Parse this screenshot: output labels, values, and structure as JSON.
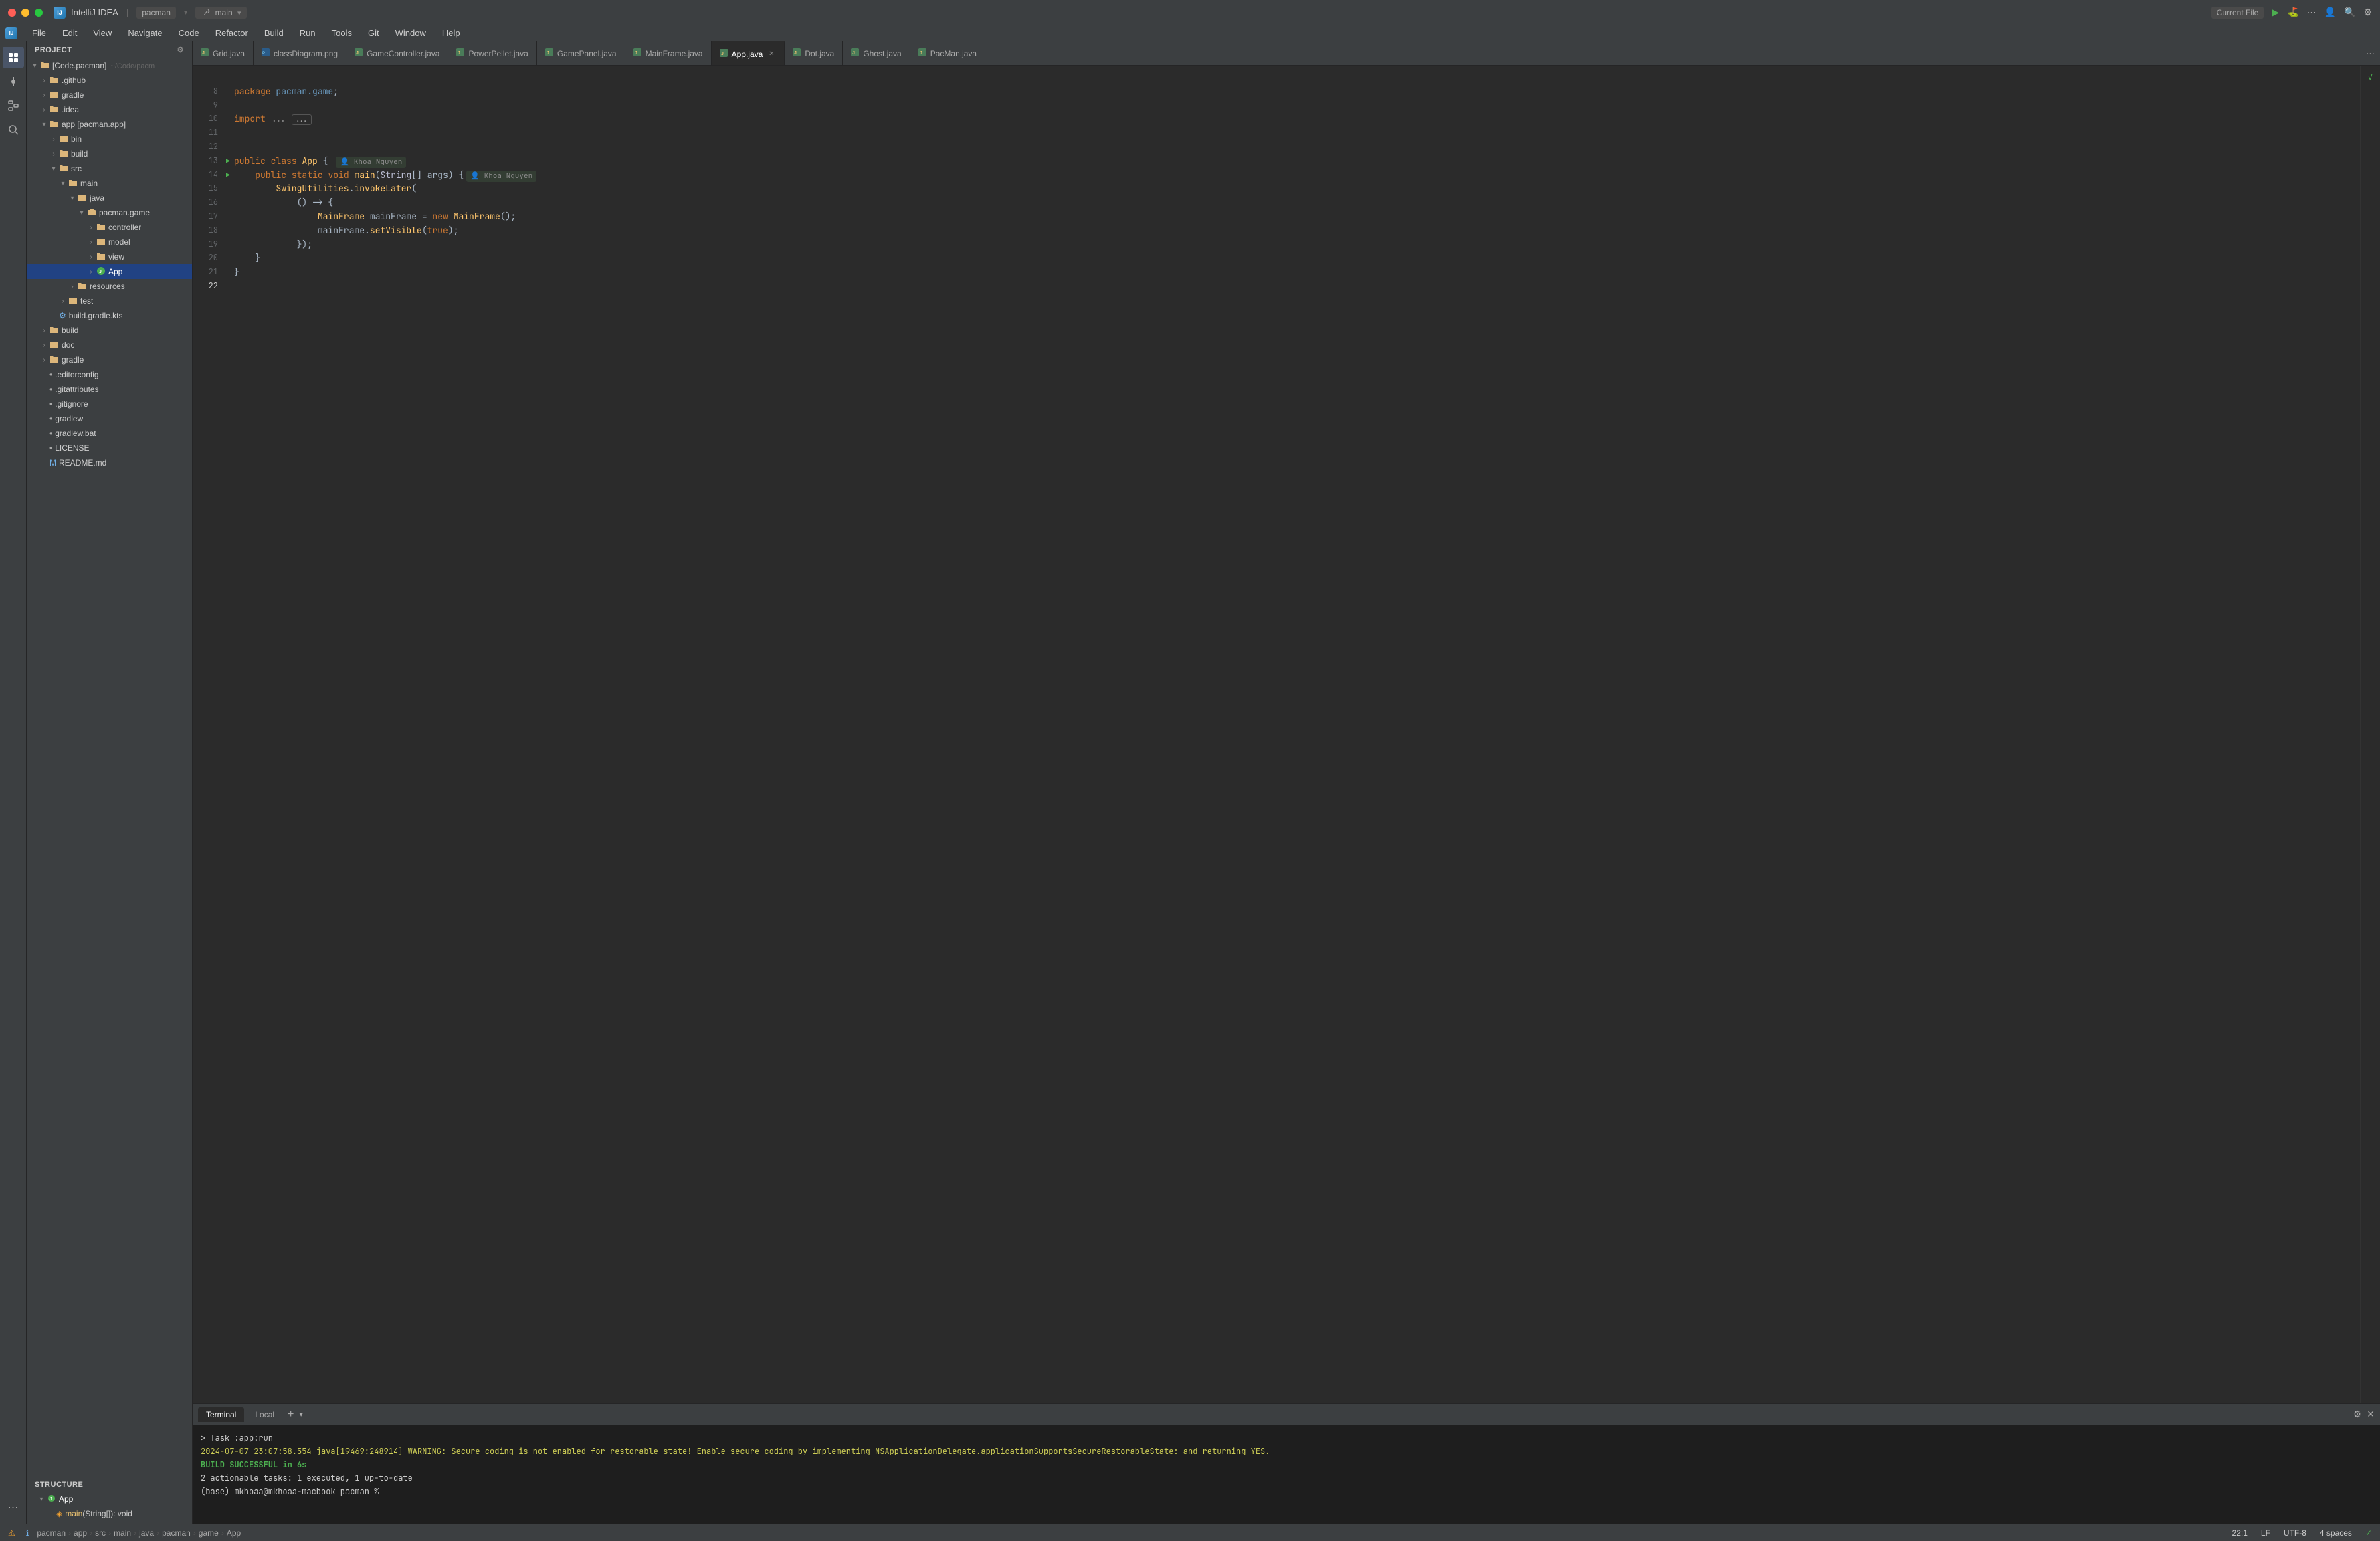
{
  "titleBar": {
    "appName": "IntelliJ IDEA",
    "projectName": "pacman",
    "branchLabel": "main",
    "branchIcon": "branch-icon",
    "currentFileLabel": "Current File",
    "runIcon": "run-icon",
    "debugIcon": "debug-icon",
    "moreIcon": "more-icon",
    "profileIcon": "profile-icon",
    "searchIcon": "search-icon",
    "settingsIcon": "settings-icon"
  },
  "menuBar": {
    "items": [
      "File",
      "Edit",
      "View",
      "Navigate",
      "Code",
      "Refactor",
      "Build",
      "Run",
      "Tools",
      "Git",
      "Window",
      "Help"
    ]
  },
  "sidebar": {
    "header": "Project",
    "tree": [
      {
        "id": "pacman-root",
        "label": "[Code.pacman]",
        "indent": 0,
        "type": "root-folder",
        "expanded": true,
        "suffix": "~/Code/pacm"
      },
      {
        "id": "github",
        "label": ".github",
        "indent": 1,
        "type": "folder",
        "expanded": false
      },
      {
        "id": "gradle-folder",
        "label": "gradle",
        "indent": 1,
        "type": "folder",
        "expanded": false
      },
      {
        "id": "idea",
        "label": ".idea",
        "indent": 1,
        "type": "folder",
        "expanded": false
      },
      {
        "id": "app-module",
        "label": "app [pacman.app]",
        "indent": 1,
        "type": "module-folder",
        "expanded": true
      },
      {
        "id": "bin",
        "label": "bin",
        "indent": 2,
        "type": "folder",
        "expanded": false
      },
      {
        "id": "build-app",
        "label": "build",
        "indent": 2,
        "type": "folder",
        "expanded": false
      },
      {
        "id": "src",
        "label": "src",
        "indent": 2,
        "type": "folder",
        "expanded": true
      },
      {
        "id": "main",
        "label": "main",
        "indent": 3,
        "type": "folder",
        "expanded": true
      },
      {
        "id": "java",
        "label": "java",
        "indent": 4,
        "type": "folder",
        "expanded": true
      },
      {
        "id": "pacman-game",
        "label": "pacman.game",
        "indent": 5,
        "type": "package",
        "expanded": true
      },
      {
        "id": "controller",
        "label": "controller",
        "indent": 6,
        "type": "folder",
        "expanded": false
      },
      {
        "id": "model",
        "label": "model",
        "indent": 6,
        "type": "folder",
        "expanded": false
      },
      {
        "id": "view",
        "label": "view",
        "indent": 6,
        "type": "folder",
        "expanded": false
      },
      {
        "id": "app-file",
        "label": "App",
        "indent": 6,
        "type": "java-run",
        "expanded": false,
        "highlighted": true
      },
      {
        "id": "resources",
        "label": "resources",
        "indent": 4,
        "type": "folder",
        "expanded": false
      },
      {
        "id": "test",
        "label": "test",
        "indent": 3,
        "type": "folder",
        "expanded": false
      },
      {
        "id": "build-gradle",
        "label": "build.gradle.kts",
        "indent": 2,
        "type": "gradle"
      },
      {
        "id": "build-root",
        "label": "build",
        "indent": 1,
        "type": "folder",
        "expanded": false
      },
      {
        "id": "doc",
        "label": "doc",
        "indent": 1,
        "type": "folder",
        "expanded": false
      },
      {
        "id": "gradle-root",
        "label": "gradle",
        "indent": 1,
        "type": "folder",
        "expanded": false
      },
      {
        "id": "editorconfig",
        "label": ".editorconfig",
        "indent": 1,
        "type": "file"
      },
      {
        "id": "gitattributes",
        "label": ".gitattributes",
        "indent": 1,
        "type": "file"
      },
      {
        "id": "gitignore",
        "label": ".gitignore",
        "indent": 1,
        "type": "file"
      },
      {
        "id": "gradlew",
        "label": "gradlew",
        "indent": 1,
        "type": "file"
      },
      {
        "id": "gradlew-bat",
        "label": "gradlew.bat",
        "indent": 1,
        "type": "file"
      },
      {
        "id": "license",
        "label": "LICENSE",
        "indent": 1,
        "type": "file"
      },
      {
        "id": "readme",
        "label": "README.md",
        "indent": 1,
        "type": "md"
      }
    ]
  },
  "structure": {
    "header": "Structure",
    "items": [
      {
        "id": "app-class",
        "label": "App",
        "type": "class",
        "expanded": true
      },
      {
        "id": "main-method",
        "label": "main(String[]): void",
        "type": "method"
      }
    ]
  },
  "tabs": [
    {
      "id": "grid",
      "label": "Grid.java",
      "type": "java",
      "active": false
    },
    {
      "id": "class-diagram",
      "label": "classDiagram.png",
      "type": "png",
      "active": false
    },
    {
      "id": "game-controller",
      "label": "GameController.java",
      "type": "java",
      "active": false
    },
    {
      "id": "power-pellet",
      "label": "PowerPellet.java",
      "type": "java",
      "active": false
    },
    {
      "id": "game-panel",
      "label": "GamePanel.java",
      "type": "java",
      "active": false
    },
    {
      "id": "main-frame",
      "label": "MainFrame.java",
      "type": "java",
      "active": false
    },
    {
      "id": "app-tab",
      "label": "App.java",
      "type": "java",
      "active": true
    },
    {
      "id": "dot",
      "label": "Dot.java",
      "type": "java",
      "active": false
    },
    {
      "id": "ghost",
      "label": "Ghost.java",
      "type": "java",
      "active": false
    },
    {
      "id": "pacman-tab",
      "label": "PacMan.java",
      "type": "java",
      "active": false
    }
  ],
  "codeLines": [
    {
      "num": "8",
      "content": "package pacman.game;",
      "tokens": [
        {
          "t": "kw",
          "v": "package"
        },
        {
          "t": "txt",
          "v": " "
        },
        {
          "t": "pkg",
          "v": "pacman.game"
        },
        {
          "t": "txt",
          "v": ";"
        }
      ]
    },
    {
      "num": "9",
      "content": ""
    },
    {
      "num": "10",
      "content": "import ...;",
      "tokens": [
        {
          "t": "imp",
          "v": "import"
        },
        {
          "t": "txt",
          "v": " "
        },
        {
          "t": "cmt",
          "v": "..."
        }
      ],
      "folded": true
    },
    {
      "num": "11",
      "content": ""
    },
    {
      "num": "12",
      "content": ""
    },
    {
      "num": "13",
      "content": "public class App {",
      "author": "Khoa Nguyen",
      "hasRunBtn": true,
      "tokens": [
        {
          "t": "kw",
          "v": "public"
        },
        {
          "t": "txt",
          "v": " "
        },
        {
          "t": "kw",
          "v": "class"
        },
        {
          "t": "txt",
          "v": " "
        },
        {
          "t": "cn",
          "v": "App"
        },
        {
          "t": "txt",
          "v": " {"
        }
      ]
    },
    {
      "num": "14",
      "content": "    public static void main(String[] args) {",
      "hasRunBtn": true,
      "author2": "Khoa Nguyen",
      "tokens": [
        {
          "t": "txt",
          "v": "    "
        },
        {
          "t": "kw",
          "v": "public"
        },
        {
          "t": "txt",
          "v": " "
        },
        {
          "t": "kw",
          "v": "static"
        },
        {
          "t": "txt",
          "v": " "
        },
        {
          "t": "kw",
          "v": "void"
        },
        {
          "t": "txt",
          "v": " "
        },
        {
          "t": "fn",
          "v": "main"
        },
        {
          "t": "txt",
          "v": "("
        },
        {
          "t": "type",
          "v": "String"
        },
        {
          "t": "txt",
          "v": "[] "
        },
        {
          "t": "txt",
          "v": "args) {"
        }
      ]
    },
    {
      "num": "15",
      "content": "        SwingUtilities.invokeLater(",
      "tokens": [
        {
          "t": "txt",
          "v": "        "
        },
        {
          "t": "cn",
          "v": "SwingUtilities"
        },
        {
          "t": "txt",
          "v": "."
        },
        {
          "t": "fn",
          "v": "invokeLater"
        },
        {
          "t": "txt",
          "v": "("
        }
      ]
    },
    {
      "num": "16",
      "content": "            () -> {",
      "tokens": [
        {
          "t": "txt",
          "v": "            () -> {"
        }
      ]
    },
    {
      "num": "17",
      "content": "                MainFrame mainFrame = new MainFrame();",
      "tokens": [
        {
          "t": "txt",
          "v": "                "
        },
        {
          "t": "cn",
          "v": "MainFrame"
        },
        {
          "t": "txt",
          "v": " mainFrame = "
        },
        {
          "t": "kw",
          "v": "new"
        },
        {
          "t": "txt",
          "v": " "
        },
        {
          "t": "cn",
          "v": "MainFrame"
        },
        {
          "t": "txt",
          "v": "();"
        }
      ]
    },
    {
      "num": "18",
      "content": "                mainFrame.setVisible(true);",
      "tokens": [
        {
          "t": "txt",
          "v": "                mainFrame."
        },
        {
          "t": "fn",
          "v": "setVisible"
        },
        {
          "t": "txt",
          "v": "("
        },
        {
          "t": "bool",
          "v": "true"
        },
        {
          "t": "txt",
          "v": ");"
        }
      ]
    },
    {
      "num": "19",
      "content": "            });",
      "tokens": [
        {
          "t": "txt",
          "v": "            });"
        }
      ]
    },
    {
      "num": "20",
      "content": "    }",
      "tokens": [
        {
          "t": "txt",
          "v": "    }"
        }
      ]
    },
    {
      "num": "21",
      "content": "}",
      "tokens": [
        {
          "t": "txt",
          "v": "}"
        }
      ]
    },
    {
      "num": "22",
      "content": ""
    }
  ],
  "terminal": {
    "tabs": [
      {
        "id": "terminal",
        "label": "Terminal",
        "active": true
      },
      {
        "id": "local",
        "label": "Local",
        "active": false
      }
    ],
    "addLabel": "+",
    "dropdownLabel": "▾",
    "lines": [
      {
        "type": "cmd",
        "text": "> Task :app:run"
      },
      {
        "type": "warn",
        "text": "2024-07-07 23:07:58.554 java[19469:248914] WARNING: Secure coding is not enabled for restorable state! Enable secure coding by implementing NSApplicationDelegate.applicationSupportsSecureRestorableState: and returning YES."
      },
      {
        "type": "success",
        "text": "BUILD SUCCESSFUL in 6s"
      },
      {
        "type": "info",
        "text": "2 actionable tasks: 1 executed, 1 up-to-date"
      },
      {
        "type": "prompt",
        "text": "(base) mkhoaa@mkhoaa-macbook pacman %"
      }
    ]
  },
  "statusBar": {
    "breadcrumb": [
      "pacman",
      "app",
      "src",
      "main",
      "java",
      "pacman",
      "game",
      "App"
    ],
    "position": "22:1",
    "encoding": "LF",
    "charset": "UTF-8",
    "indent": "4 spaces",
    "warnCount": "",
    "infoCount": ""
  }
}
